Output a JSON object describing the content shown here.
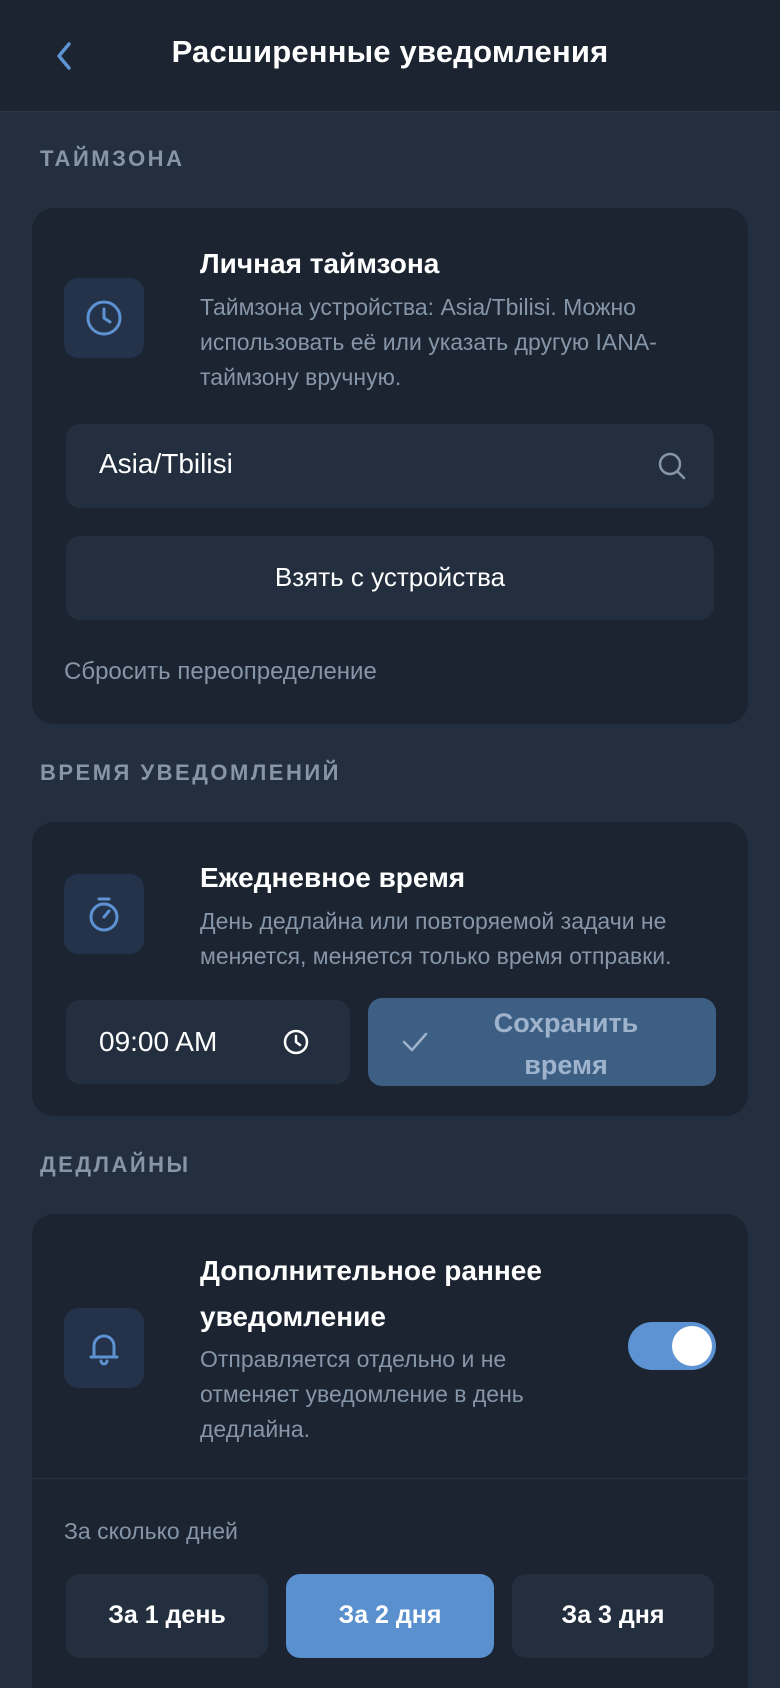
{
  "header": {
    "title": "Расширенные уведомления",
    "back_icon": "chevron-left-icon"
  },
  "colors": {
    "background": "#232f3f",
    "card": "#1b2430",
    "accent": "#5d92d3",
    "muted_text": "#8695a8",
    "disabled_button": "#3e5f84"
  },
  "timezone_section": {
    "label": "ТАЙМЗОНА",
    "card_title": "Личная таймзона",
    "description": "Таймзона устройства: Asia/Tbilisi. Можно использовать её или указать другую IANA-таймзону вручную.",
    "icon": "clock-icon",
    "input_value": "Asia/Tbilisi",
    "search_icon": "search-icon",
    "device_button": "Взять с устройства",
    "reset_link": "Сбросить переопределение"
  },
  "notification_time_section": {
    "label": "ВРЕМЯ УВЕДОМЛЕНИЙ",
    "card_title": "Ежедневное время",
    "description": "День дедлайна или повторяемой задачи не меняется, меняется только время отправки.",
    "icon": "stopwatch-icon",
    "time_value": "09:00 AM",
    "time_icon": "clock-icon",
    "save_button": "Сохранить время",
    "save_icon": "checkmark-icon"
  },
  "deadlines_section": {
    "label": "ДЕДЛАЙНЫ",
    "card_title": "Дополнительное раннее уведомление",
    "description": "Отправляется отдельно и не отменяет уведомление в день дедлайна.",
    "icon": "bell-icon",
    "toggle_on": true,
    "days_label": "За сколько дней",
    "day_options": [
      {
        "label": "За 1 день",
        "selected": false
      },
      {
        "label": "За 2 дня",
        "selected": true
      },
      {
        "label": "За 3 дня",
        "selected": false
      }
    ]
  }
}
